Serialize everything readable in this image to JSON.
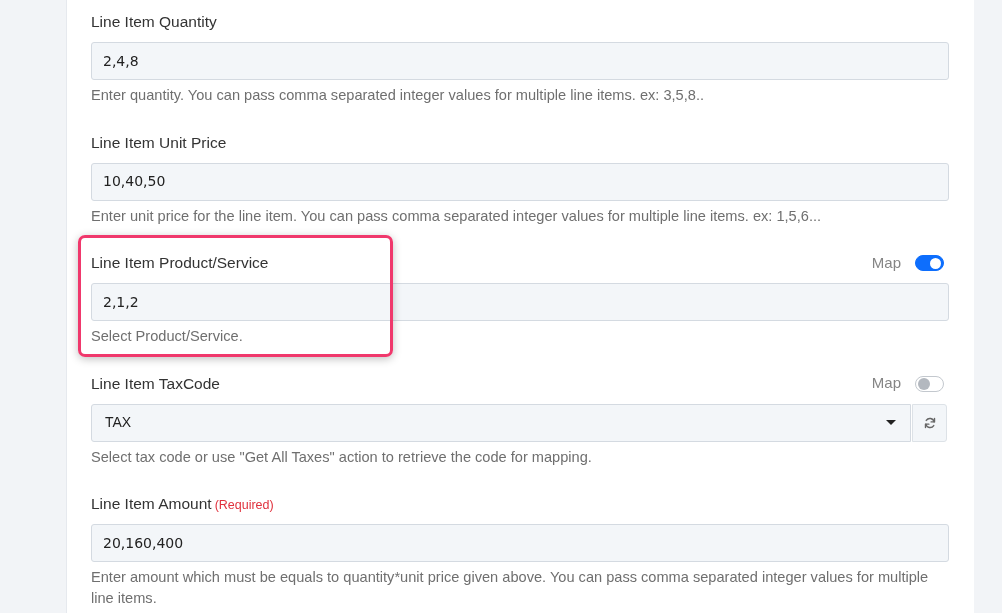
{
  "fields": [
    {
      "kind": "text",
      "label": "Line Item Quantity",
      "value": "2,4,8",
      "help": "Enter quantity. You can pass comma separated integer values for multiple line items. ex: 3,5,8..",
      "highlighted": false
    },
    {
      "kind": "text",
      "label": "Line Item Unit Price",
      "value": "10,40,50",
      "help": "Enter unit price for the line item. You can pass comma separated integer values for multiple line items. ex: 1,5,6...",
      "highlighted": false
    },
    {
      "kind": "text",
      "label": "Line Item Product/Service",
      "map": {
        "label": "Map",
        "on": true
      },
      "value": "2,1,2",
      "help": "Select Product/Service.",
      "highlighted": true
    },
    {
      "kind": "select",
      "label": "Line Item TaxCode",
      "map": {
        "label": "Map",
        "on": false
      },
      "value": "TAX",
      "help": "Select tax code or use \"Get All Taxes\" action to retrieve the code for mapping.",
      "highlighted": false
    },
    {
      "kind": "text",
      "label": "Line Item Amount",
      "required_note": "(Required)",
      "value": "20,160,400",
      "help": "Enter amount which must be equals to quantity*unit price given above. You can pass comma separated integer values for multiple line items.",
      "highlighted": false
    }
  ]
}
